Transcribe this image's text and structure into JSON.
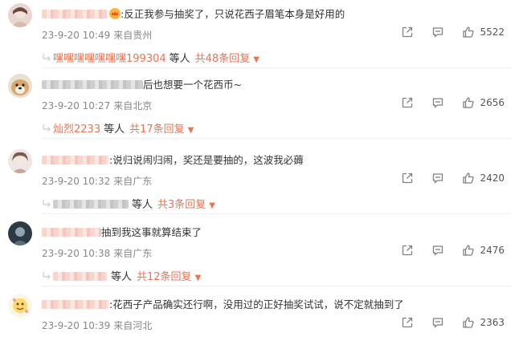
{
  "comments": [
    {
      "text": ":反正我参与抽奖了，只说花西子眉笔本身是好用的",
      "time": "23-9-20 10:49",
      "location": "来自贵州",
      "likes": "5522",
      "has_vip_badge": true,
      "reply_user": "嘿嘿嘿嘿嘿嘿嘿199304",
      "deng": "等人",
      "reply_total": "共48条回复"
    },
    {
      "text": "后也想要一个花西币~",
      "time": "23-9-20 10:27",
      "location": "来自北京",
      "likes": "2656",
      "reply_user": "灿烈2233",
      "deng": "等人",
      "reply_total": "共17条回复"
    },
    {
      "text": ":说归说闹归闹，奖还是要抽的，这波我必薅",
      "time": "23-9-20 10:32",
      "location": "来自广东",
      "likes": "2420",
      "reply_user": "",
      "deng": "等人",
      "reply_total": "共3条回复"
    },
    {
      "text": "抽到我这事就算结束了",
      "time": "23-9-20 10:38",
      "location": "来自广东",
      "likes": "2476",
      "reply_user": "",
      "deng": "等人",
      "reply_total": "共12条回复"
    },
    {
      "text": ":花西子产品确实还行啊，没用过的正好抽奖试试，说不定就抽到了",
      "time": "23-9-20 10:39",
      "location": "来自河北",
      "likes": "2363"
    }
  ],
  "caret": "▼",
  "icons": [
    "share-icon",
    "comment-icon",
    "like-icon",
    "reply-arrow-icon"
  ],
  "colors": {
    "accent": "#eb7350",
    "meta": "#888888",
    "icon": "#808080"
  }
}
